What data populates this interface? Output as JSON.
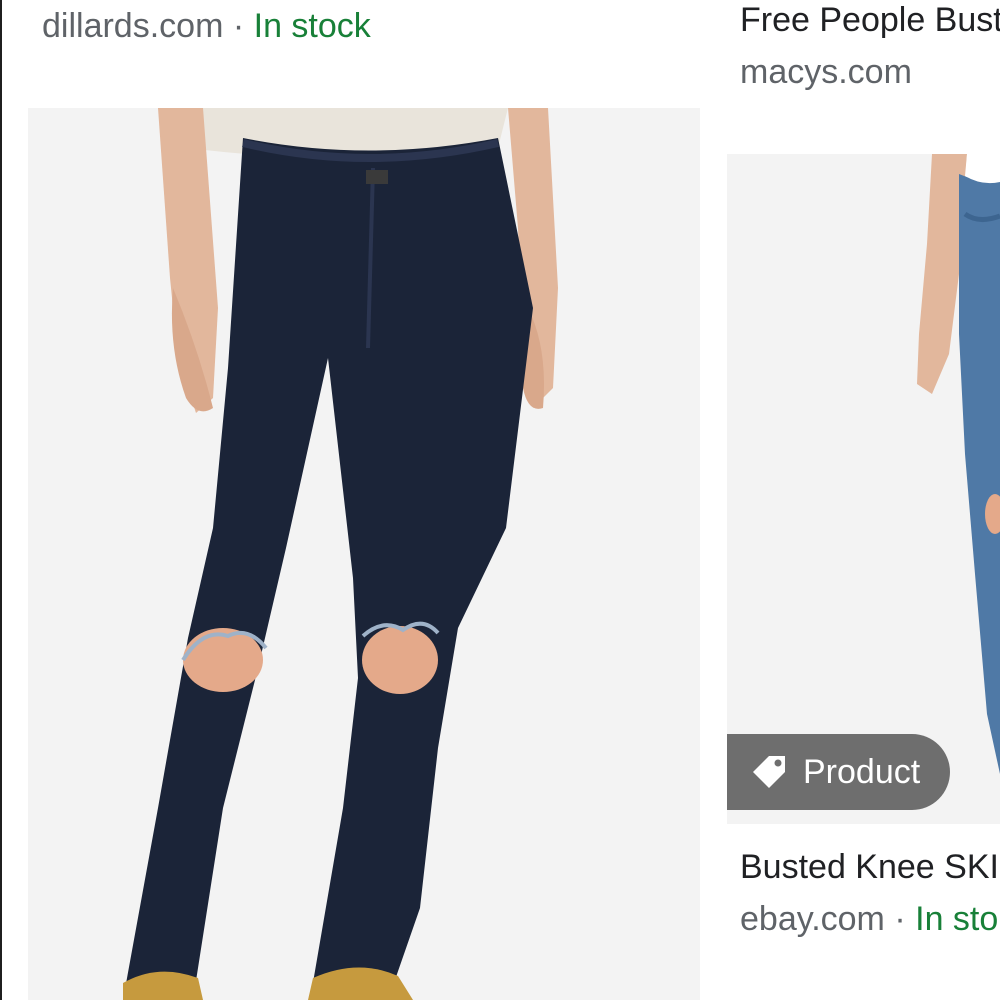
{
  "left_card": {
    "source": "dillards.com",
    "separator": "·",
    "stock_status": "In stock"
  },
  "right_card_top": {
    "title": "Free People Bust",
    "source": "macys.com"
  },
  "right_card_bottom": {
    "badge_label": "Product",
    "badge_icon": "tag-icon",
    "title": "Busted Knee SKI",
    "source": "ebay.com",
    "separator": "·",
    "stock_status": "In sto"
  },
  "colors": {
    "stock_green": "#188038",
    "source_gray": "#5f6368",
    "title_text": "#202124",
    "badge_bg": "#6e6e6e",
    "denim_dark": "#1b2438",
    "denim_light": "#4f79a6"
  }
}
